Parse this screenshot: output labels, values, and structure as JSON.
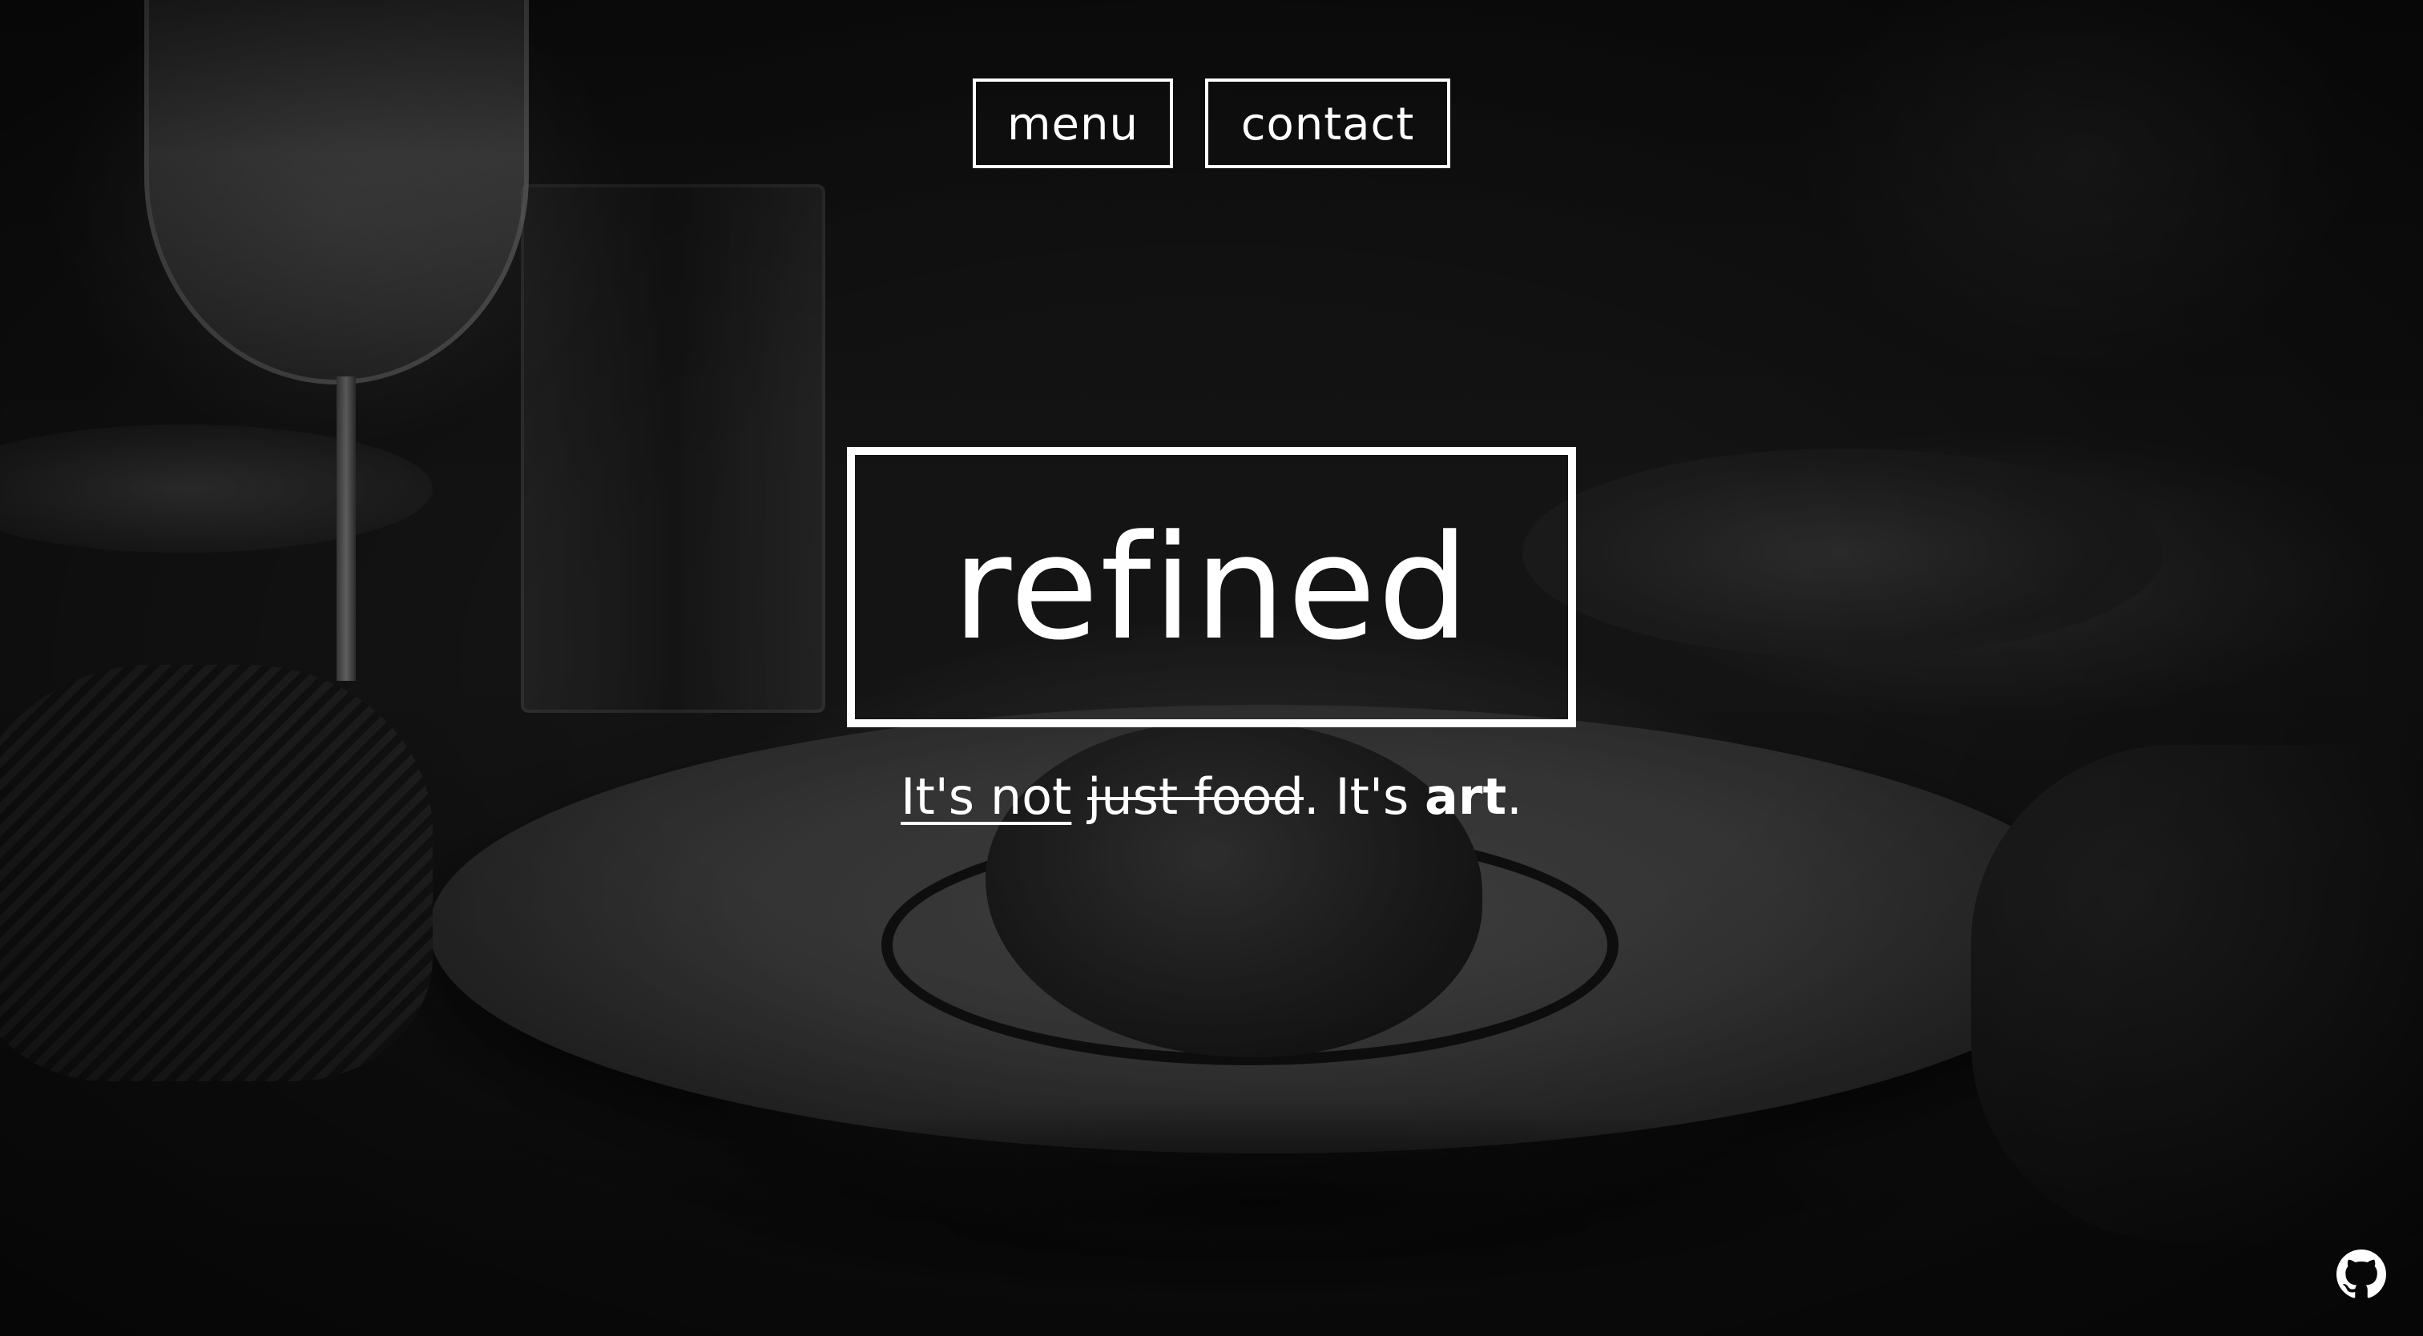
{
  "nav": {
    "menu_label": "menu",
    "contact_label": "contact"
  },
  "hero": {
    "title": "refined",
    "tagline": {
      "part1_underlined": "It's not",
      "space1": " ",
      "part2_struck": "just food",
      "part3": ". It's ",
      "part4_bold": "art",
      "part5": "."
    }
  },
  "footer": {
    "github_icon": "github-icon"
  },
  "colors": {
    "text": "#ffffff",
    "overlay": "#000000"
  }
}
